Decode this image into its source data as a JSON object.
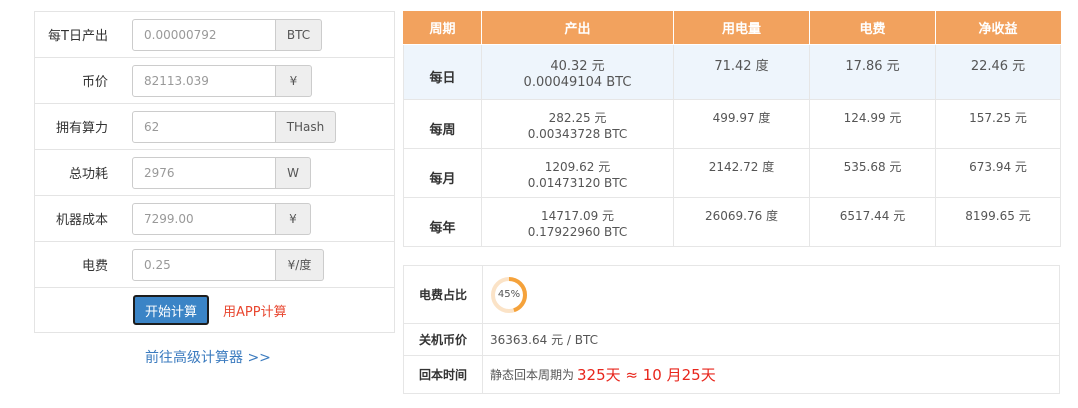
{
  "form": {
    "rows": [
      {
        "label": "每T日产出",
        "value": "0.00000792",
        "unit": "BTC"
      },
      {
        "label": "币价",
        "value": "82113.039",
        "unit": "¥"
      },
      {
        "label": "拥有算力",
        "value": "62",
        "unit": "THash"
      },
      {
        "label": "总功耗",
        "value": "2976",
        "unit": "W"
      },
      {
        "label": "机器成本",
        "value": "7299.00",
        "unit": "¥"
      },
      {
        "label": "电费",
        "value": "0.25",
        "unit": "¥/度"
      }
    ],
    "calc_button": "开始计算",
    "app_link": "用APP计算"
  },
  "advanced_link": "前往高级计算器 >>",
  "results": {
    "headers": [
      "周期",
      "产出",
      "用电量",
      "电费",
      "净收益"
    ],
    "rows": [
      {
        "period": "每日",
        "output_cny": "40.32 元",
        "output_btc": "0.00049104 BTC",
        "power": "71.42 度",
        "fee": "17.86 元",
        "net": "22.46 元"
      },
      {
        "period": "每周",
        "output_cny": "282.25 元",
        "output_btc": "0.00343728 BTC",
        "power": "499.97 度",
        "fee": "124.99 元",
        "net": "157.25 元"
      },
      {
        "period": "每月",
        "output_cny": "1209.62 元",
        "output_btc": "0.01473120 BTC",
        "power": "2142.72 度",
        "fee": "535.68 元",
        "net": "673.94 元"
      },
      {
        "period": "每年",
        "output_cny": "14717.09 元",
        "output_btc": "0.17922960 BTC",
        "power": "26069.76 度",
        "fee": "6517.44 元",
        "net": "8199.65 元"
      }
    ]
  },
  "info": {
    "fee_ratio_label": "电费占比",
    "fee_ratio_text": "45%",
    "fee_ratio_value": 0.45,
    "fee_ratio_color": "#f5a23b",
    "fee_ratio_track_color": "#fbe3c7",
    "shutdown_label": "关机币价",
    "shutdown_value": "36363.64 元 / BTC",
    "payback_label": "回本时间",
    "payback_prefix": "静态回本周期为",
    "payback_value": "325天 ≈ 10 月25天"
  }
}
